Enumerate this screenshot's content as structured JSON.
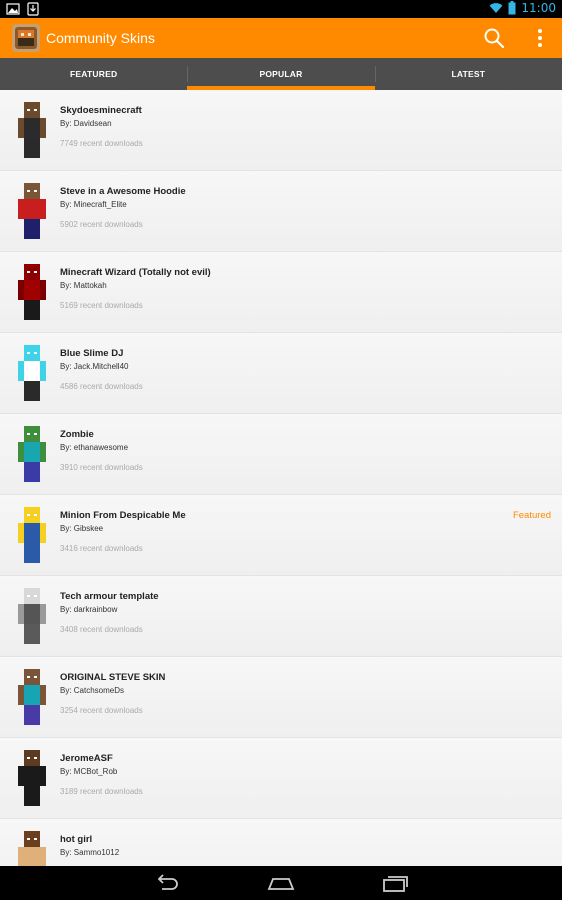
{
  "status_bar": {
    "time": "11:00",
    "icons": [
      "gallery-icon",
      "download-icon",
      "wifi-icon",
      "battery-icon"
    ]
  },
  "action_bar": {
    "title": "Community Skins",
    "icons": [
      "app-icon",
      "search-icon",
      "overflow-menu-icon"
    ],
    "color": "#ff8a00"
  },
  "tabs": [
    {
      "label": "FEATURED",
      "active": false
    },
    {
      "label": "POPULAR",
      "active": true
    },
    {
      "label": "LATEST",
      "active": false
    }
  ],
  "skins": [
    {
      "title": "Skydoesminecraft",
      "author": "By: Davidsean",
      "downloads": "7749 recent downloads",
      "badge": "",
      "colors": {
        "head": "#6b4a2e",
        "body": "#2b2b2b",
        "arms": "#6b4a2e",
        "legs": "#2a2a2a"
      }
    },
    {
      "title": "Steve in a Awesome Hoodie",
      "author": "By: Minecraft_Elite",
      "downloads": "5902 recent downloads",
      "badge": "",
      "colors": {
        "head": "#7b5537",
        "body": "#c81e1e",
        "arms": "#c81e1e",
        "legs": "#1f1f6a"
      }
    },
    {
      "title": "Minecraft Wizard (Totally not evil)",
      "author": "By: Mattokah",
      "downloads": "5169 recent downloads",
      "badge": "",
      "colors": {
        "head": "#8b0000",
        "body": "#a00000",
        "arms": "#7a0000",
        "legs": "#1a1a1a"
      }
    },
    {
      "title": "Blue Slime DJ",
      "author": "By: Jack.Mitchell40",
      "downloads": "4586 recent downloads",
      "badge": "",
      "colors": {
        "head": "#3fd3e8",
        "body": "#ffffff",
        "arms": "#3fd3e8",
        "legs": "#2a2a2a"
      }
    },
    {
      "title": "Zombie",
      "author": "By: ethanawesome",
      "downloads": "3910 recent downloads",
      "badge": "",
      "colors": {
        "head": "#3e8e3e",
        "body": "#1aa6b0",
        "arms": "#3e8e3e",
        "legs": "#3b3ba8"
      }
    },
    {
      "title": "Minion From Despicable Me",
      "author": "By: Gibskee",
      "downloads": "3416 recent downloads",
      "badge": "Featured",
      "colors": {
        "head": "#f5d020",
        "body": "#2a5aa8",
        "arms": "#f5d020",
        "legs": "#2a5aa8"
      }
    },
    {
      "title": "Tech armour template",
      "author": "By: darkrainbow",
      "downloads": "3408 recent downloads",
      "badge": "",
      "colors": {
        "head": "#d8d8d8",
        "body": "#555555",
        "arms": "#9a9a9a",
        "legs": "#5a5a5a"
      }
    },
    {
      "title": "ORIGINAL STEVE SKIN",
      "author": "By: CatchsomeDs",
      "downloads": "3254 recent downloads",
      "badge": "",
      "colors": {
        "head": "#7b5537",
        "body": "#17a5b5",
        "arms": "#7b5537",
        "legs": "#4a3aa8"
      }
    },
    {
      "title": "JeromeASF",
      "author": "By: MCBot_Rob",
      "downloads": "3189 recent downloads",
      "badge": "",
      "colors": {
        "head": "#5b3b22",
        "body": "#1a1a1a",
        "arms": "#1a1a1a",
        "legs": "#1a1a1a"
      }
    },
    {
      "title": "hot girl",
      "author": "By: Sammo1012",
      "downloads": "",
      "badge": "",
      "colors": {
        "head": "#6b3f1e",
        "body": "#e0b07a",
        "arms": "#e0b07a",
        "legs": "#e0b07a"
      }
    }
  ],
  "nav_bar": {
    "icons": [
      "back-icon",
      "home-icon",
      "recent-apps-icon"
    ]
  }
}
